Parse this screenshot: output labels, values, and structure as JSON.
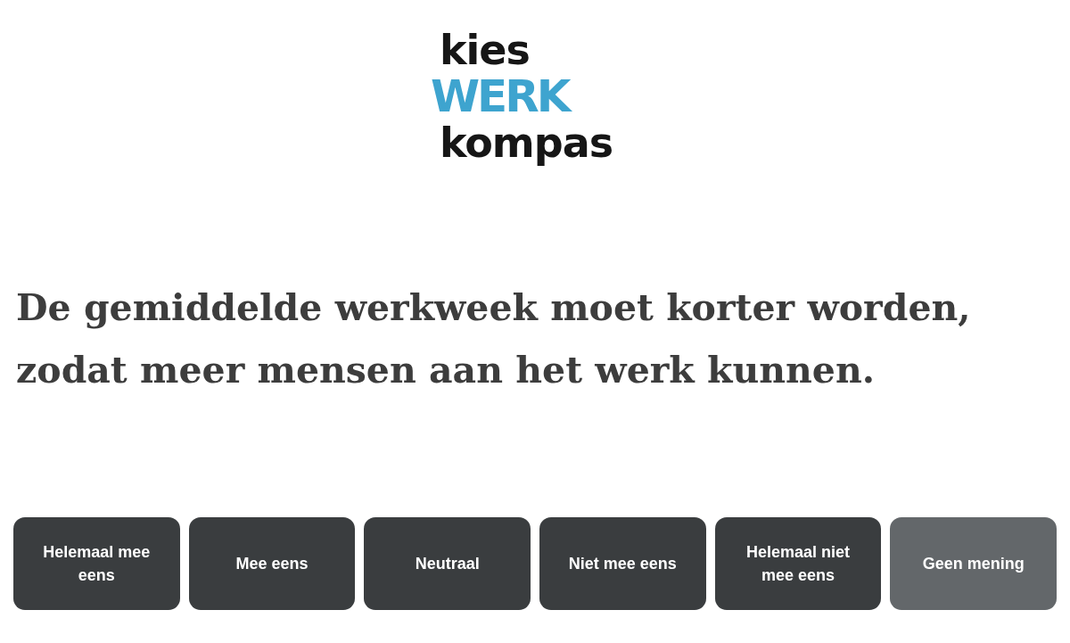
{
  "logo": {
    "lines": [
      {
        "text": "kies",
        "kind": "dark"
      },
      {
        "text": "WERK",
        "kind": "accent"
      },
      {
        "text": "kompas",
        "kind": "dark"
      }
    ]
  },
  "statement": "De gemiddelde werkweek moet korter worden, zodat meer mensen aan het werk kunnen.",
  "answers": [
    {
      "label": "Helemaal mee eens",
      "kind": "answer"
    },
    {
      "label": "Mee eens",
      "kind": "answer"
    },
    {
      "label": "Neutraal",
      "kind": "answer"
    },
    {
      "label": "Niet mee eens",
      "kind": "answer"
    },
    {
      "label": "Helemaal niet mee eens",
      "kind": "answer"
    },
    {
      "label": "Geen mening",
      "kind": "skip"
    }
  ]
}
